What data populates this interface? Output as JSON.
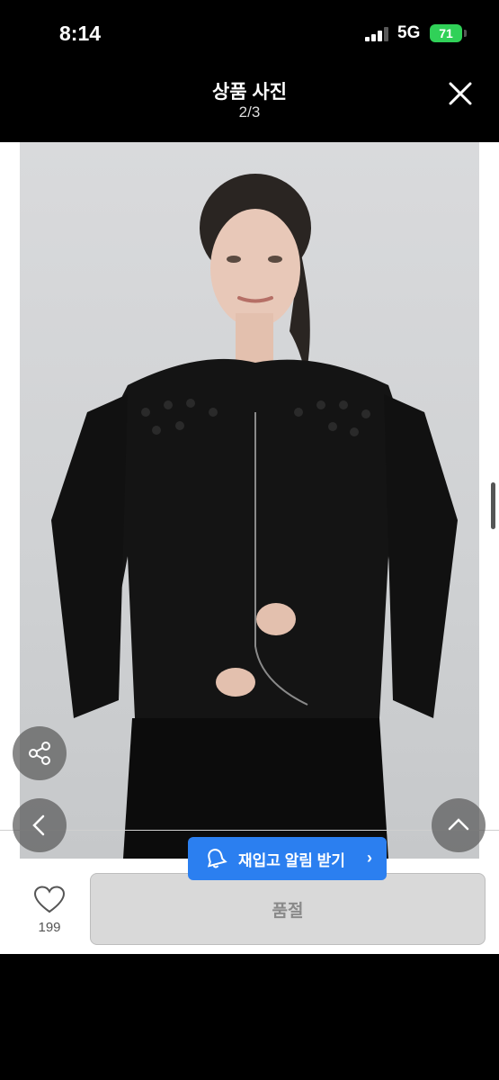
{
  "status": {
    "time": "8:14",
    "network": "5G",
    "battery": "71"
  },
  "header": {
    "title": "상품 사진",
    "page_indicator": "2/3"
  },
  "product": {
    "like_count": "199",
    "soldout_label": "품절"
  },
  "restock": {
    "label": "재입고 알림 받기",
    "arrow": "›"
  },
  "icons": {
    "close": "close-icon",
    "share": "share-icon",
    "prev": "chevron-left-icon",
    "top": "chevron-up-icon",
    "like": "heart-icon",
    "bell": "bell-icon"
  },
  "colors": {
    "accent": "#2b7ff0",
    "battery": "#30d158",
    "soldout_bg": "#d9d9d9"
  }
}
